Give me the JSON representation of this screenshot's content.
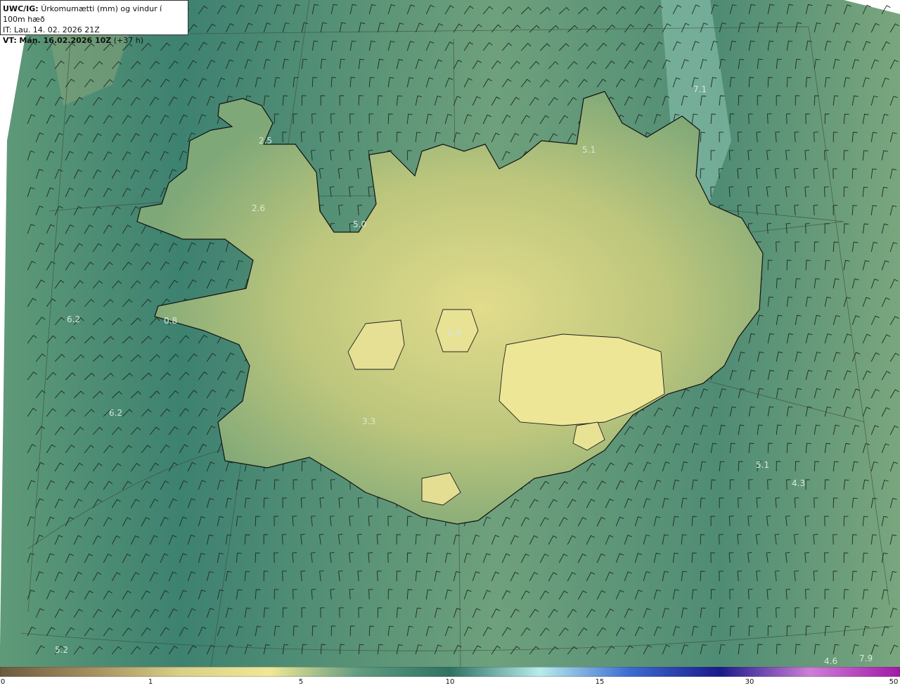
{
  "title": {
    "product": "UWC/IG:",
    "description": "Úrkomumætti (mm) og vindur í 100m hæð",
    "init_time": "IT: Lau. 14. 02. 2026 21Z",
    "valid_label": "VT:",
    "valid_time": "Mán. 16.02.2026 10Z",
    "lead": "(+37 h)"
  },
  "map_labels": [
    {
      "text": "7.1"
    },
    {
      "text": "5.1"
    },
    {
      "text": "2.5"
    },
    {
      "text": "2.6"
    },
    {
      "text": "5.0"
    },
    {
      "text": "6.2"
    },
    {
      "text": "0.8"
    },
    {
      "text": "6.2"
    },
    {
      "text": "0.9"
    },
    {
      "text": "3.3"
    },
    {
      "text": "5.1"
    },
    {
      "text": "4.3"
    },
    {
      "text": "5.2"
    },
    {
      "text": "4.6"
    },
    {
      "text": "7.9"
    }
  ],
  "colorbar": {
    "ticks": [
      {
        "label": "0",
        "value": 0
      },
      {
        "label": "1",
        "value": 1
      },
      {
        "label": "5",
        "value": 5
      },
      {
        "label": "10",
        "value": 10
      },
      {
        "label": "15",
        "value": 15
      },
      {
        "label": "30",
        "value": 30
      },
      {
        "label": "50",
        "value": 50
      }
    ],
    "colors": [
      "#6b5a3e",
      "#a58d5e",
      "#d9cf86",
      "#f0e896",
      "#5f9a80",
      "#2e7262",
      "#b8ecec",
      "#3c6bd0",
      "#1a1a8a",
      "#cd7ed6",
      "#a11aa8"
    ]
  }
}
